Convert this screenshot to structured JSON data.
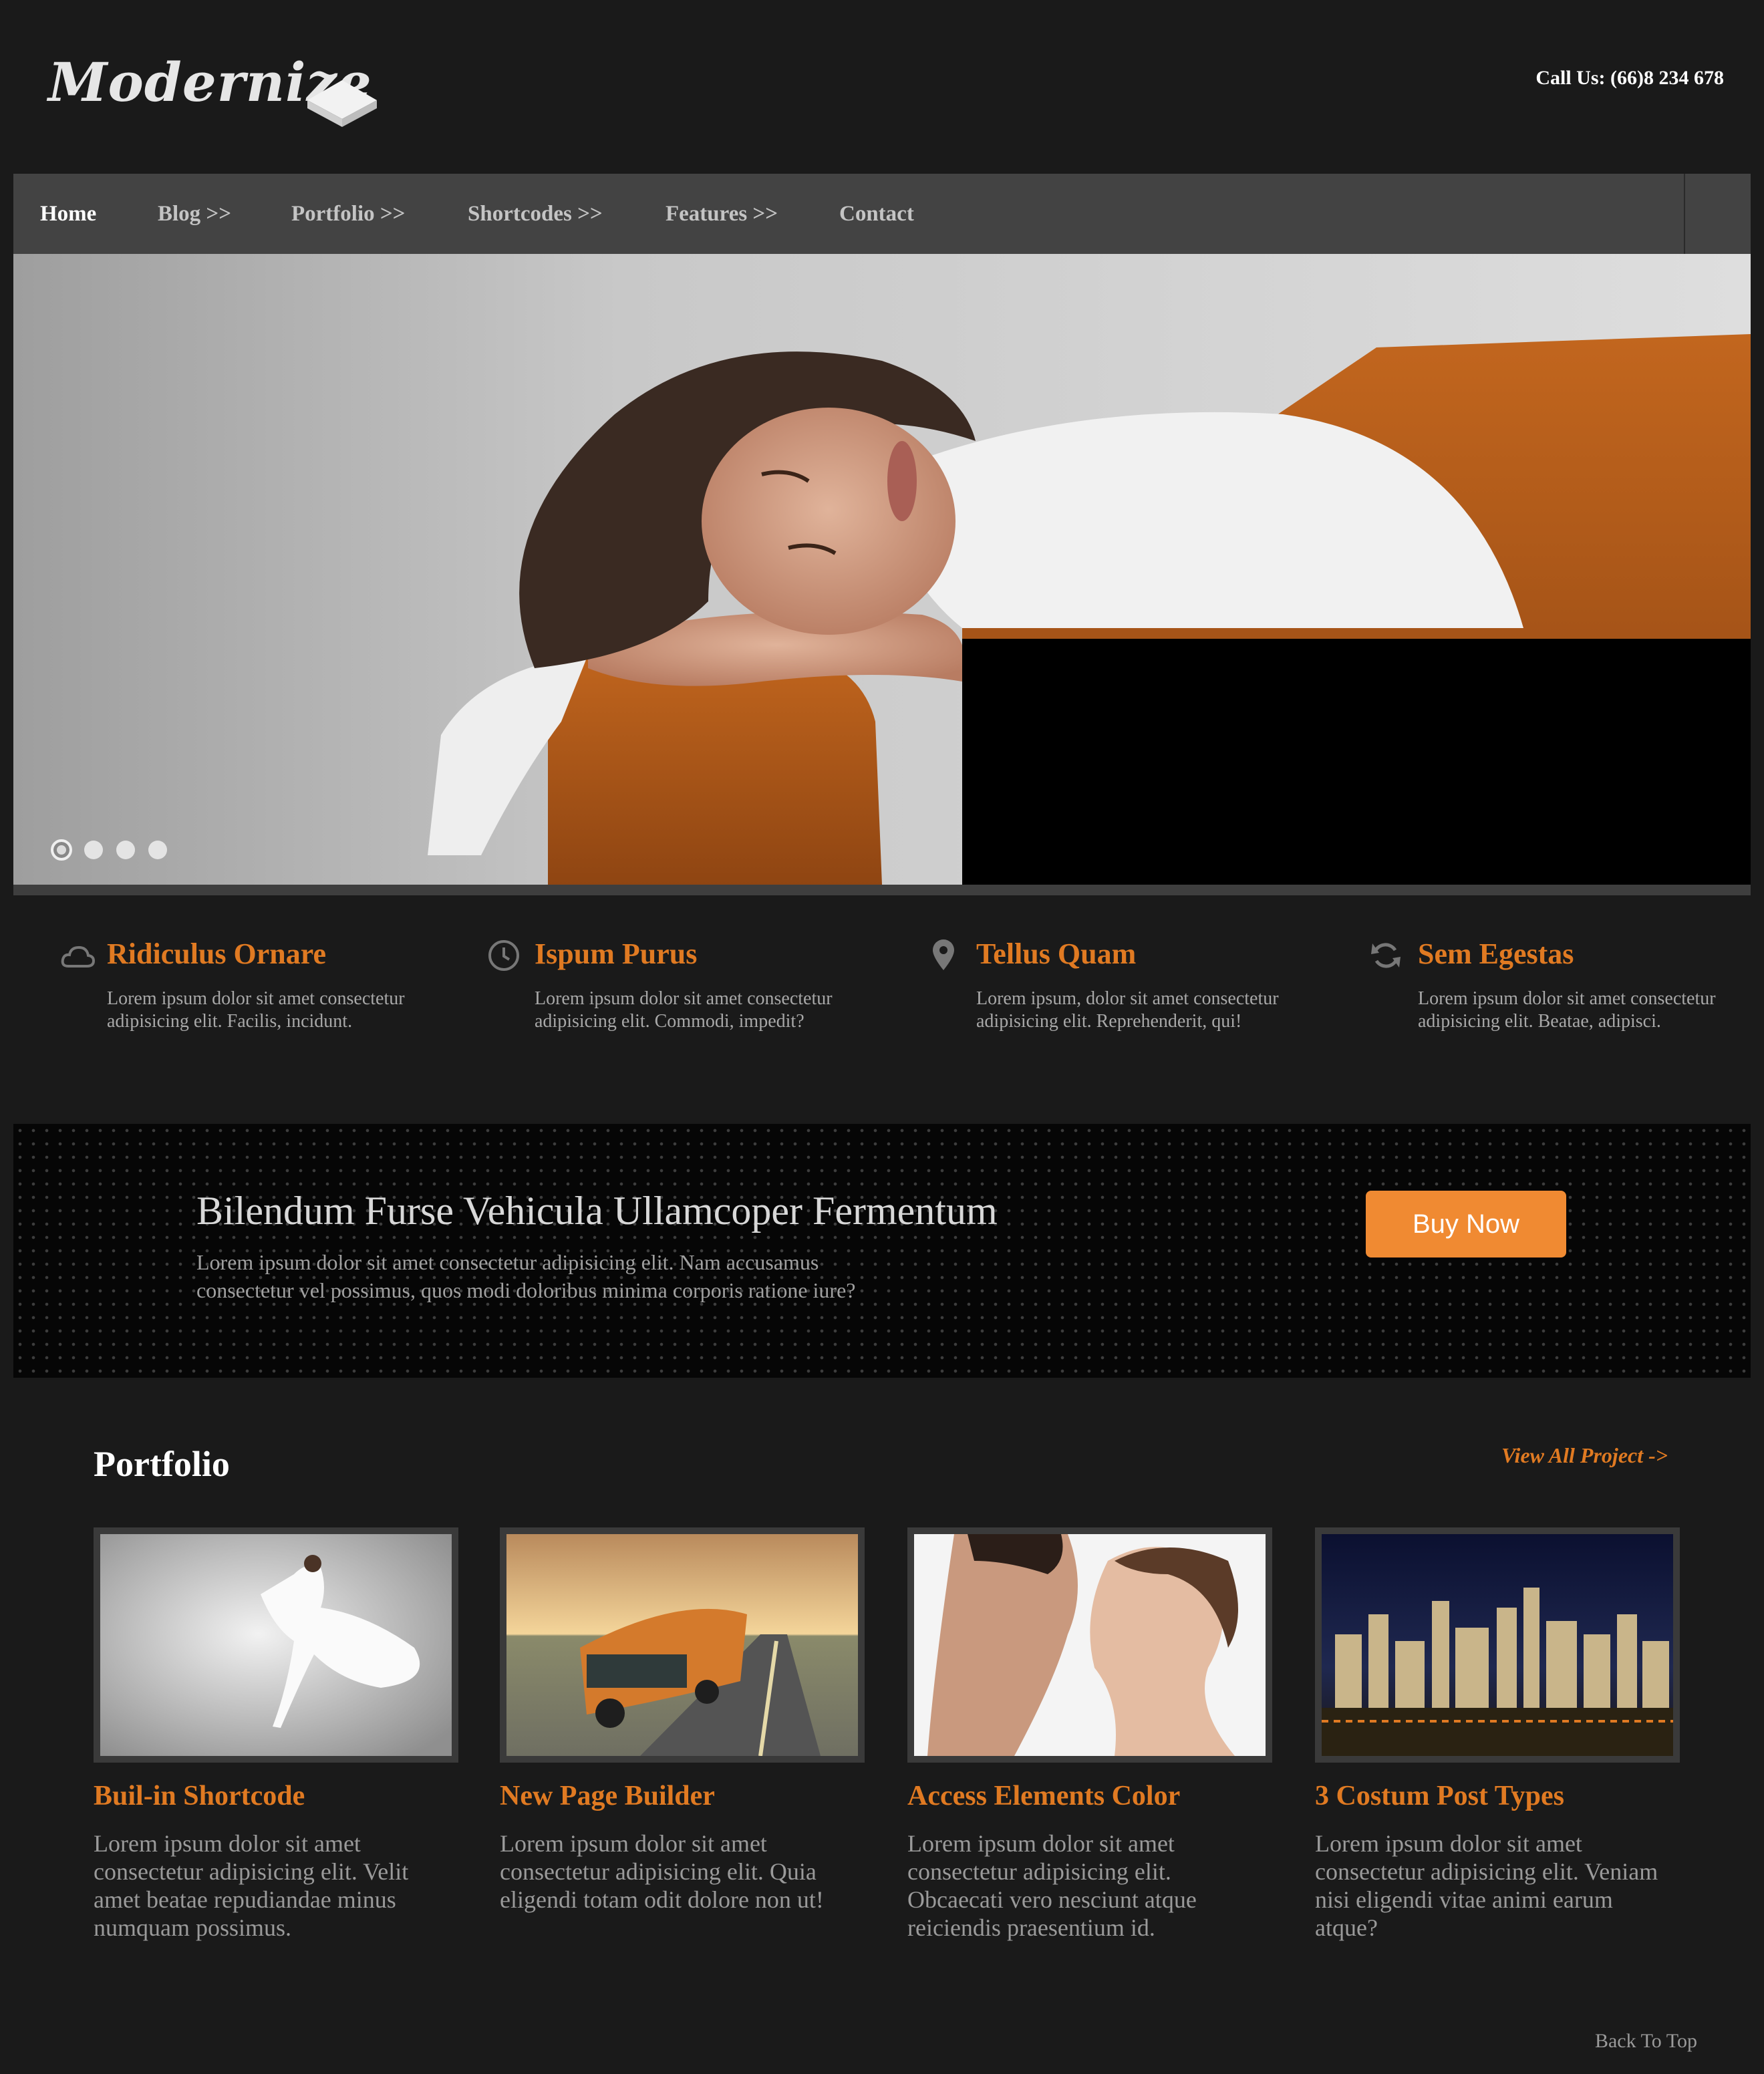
{
  "header": {
    "logo_text": "Modernize",
    "phone": "Call Us: (66)8 234 678"
  },
  "nav": {
    "items": [
      {
        "label": "Home",
        "active": true
      },
      {
        "label": "Blog >>",
        "active": false
      },
      {
        "label": "Portfolio >>",
        "active": false
      },
      {
        "label": "Shortcodes >>",
        "active": false
      },
      {
        "label": "Features >>",
        "active": false
      },
      {
        "label": "Contact",
        "active": false
      }
    ]
  },
  "slider": {
    "slide_count": 4,
    "active_slide": 1
  },
  "features": [
    {
      "icon": "cloud-icon",
      "title": "Ridiculus Ornare",
      "text": "Lorem ipsum dolor sit amet consectetur adipisicing elit. Facilis, incidunt."
    },
    {
      "icon": "clock-icon",
      "title": "Ispum Purus",
      "text": "Lorem ipsum dolor sit amet consectetur adipisicing elit. Commodi, impedit?"
    },
    {
      "icon": "map-pin-icon",
      "title": "Tellus Quam",
      "text": "Lorem ipsum, dolor sit amet consectetur adipisicing elit. Reprehenderit, qui!"
    },
    {
      "icon": "refresh-icon",
      "title": "Sem Egestas",
      "text": "Lorem ipsum dolor sit amet consectetur adipisicing elit. Beatae, adipisci."
    }
  ],
  "promo": {
    "title": "Bilendum Furse Vehicula Ullamcoper Fermentum",
    "text": "Lorem ipsum dolor sit amet consectetur adipisicing elit. Nam accusamus consectetur vel possimus, quos modi doloribus minima corporis ratione iure?",
    "button": "Buy Now",
    "button_color": "#f08a32"
  },
  "portfolio": {
    "heading": "Portfolio",
    "view_all": "View All Project ->",
    "items": [
      {
        "title": "Buil-in Shortcode",
        "text": "Lorem ipsum dolor sit amet consectetur adipisicing elit. Velit amet beatae repudiandae minus numquam possimus."
      },
      {
        "title": "New Page Builder",
        "text": "Lorem ipsum dolor sit amet consectetur adipisicing elit. Quia eligendi totam odit dolore non ut!"
      },
      {
        "title": "Access Elements Color",
        "text": "Lorem ipsum dolor sit amet consectetur adipisicing elit. Obcaecati vero nesciunt atque reiciendis praesentium id."
      },
      {
        "title": "3 Costum Post Types",
        "text": "Lorem ipsum dolor sit amet consectetur adipisicing elit. Veniam nisi eligendi vitae animi earum atque?"
      }
    ]
  },
  "footer": {
    "back_to_top": "Back To Top"
  },
  "colors": {
    "accent": "#e07a22",
    "background": "#1a1a1a",
    "nav_background": "#434343"
  }
}
